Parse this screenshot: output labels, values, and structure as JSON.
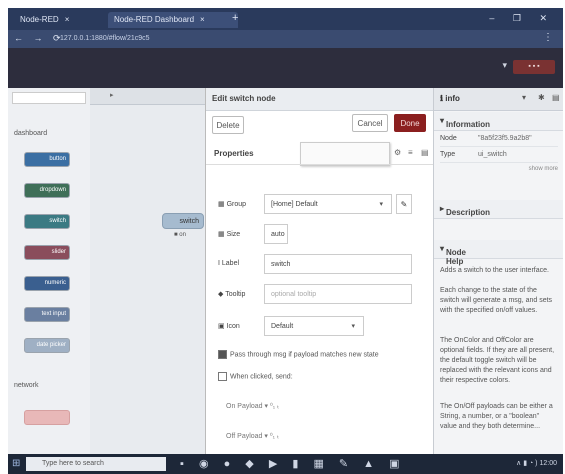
{
  "browser": {
    "tab1_label": "Node-RED",
    "tab2_label": "Node-RED Dashboard",
    "address": "127.0.0.1:1880/#flow/21c9c5"
  },
  "palette": {
    "category_dashboard": "dashboard",
    "category_network": "network",
    "nodes": [
      {
        "label": "button",
        "color": "#3b6fa3"
      },
      {
        "label": "dropdown",
        "color": "#3f6f58"
      },
      {
        "label": "switch",
        "color": "#3b7a83"
      },
      {
        "label": "slider",
        "color": "#8a4d5c"
      },
      {
        "label": "numeric",
        "color": "#3a5f8f"
      },
      {
        "label": "text input",
        "color": "#6a7fa0"
      },
      {
        "label": "date picker",
        "color": "#9fb0c4"
      }
    ]
  },
  "workspace": {
    "node_label": "switch"
  },
  "dialog": {
    "title": "Edit switch node",
    "delete": "Delete",
    "cancel": "Cancel",
    "done": "Done",
    "properties": "Properties",
    "group_label": "Group",
    "group_value": "[Home] Default",
    "size_label": "Size",
    "size_value": "auto",
    "label_label": "Label",
    "label_value": "switch",
    "tooltip_label": "Tooltip",
    "tooltip_placeholder": "optional tooltip",
    "icon_label": "Icon",
    "icon_value": "Default",
    "passthrough": "Pass through msg if payload matches new state",
    "sendon": "When clicked, send:",
    "on_payload": "On Payload",
    "off_payload": "Off Payload"
  },
  "sidebar": {
    "tab": "info",
    "information": "Information",
    "node_key": "Node",
    "node_value": "\"8a5f23f5.9a2b8\"",
    "type_key": "Type",
    "type_value": "ui_switch",
    "show_more": "show more",
    "description": "Description",
    "node_help": "Node Help",
    "help1": "Adds a switch to the user interface.",
    "help2": "Each change to the state of the switch will generate a msg, and sets with the specified on/off values.",
    "help3_b": "OnColor",
    "help3": "The OnColor and OffColor are optional fields. If they are all present, the default toggle switch will be replaced with the relevant icons and their respective colors.",
    "help4": "The On/Off payloads can be either a String, a number, or a \"boolean\" value and they both determine..."
  },
  "taskbar": {
    "search": "Type here to search",
    "clock": "12:00"
  }
}
